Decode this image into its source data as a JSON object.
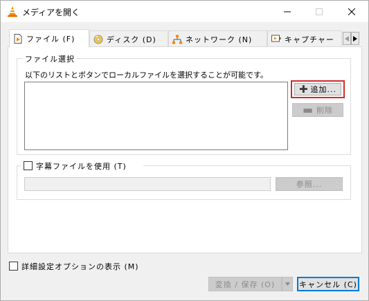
{
  "window": {
    "title": "メディアを開く"
  },
  "tabs": [
    {
      "label": "ファイル (F)",
      "icon": "file-play-icon",
      "active": true
    },
    {
      "label": "ディスク (D)",
      "icon": "disc-icon",
      "active": false
    },
    {
      "label": "ネットワーク (N)",
      "icon": "network-icon",
      "active": false
    },
    {
      "label": "キャプチャー",
      "icon": "capture-device-icon",
      "active": false
    }
  ],
  "file_selection": {
    "group_title": "ファイル選択",
    "description": "以下のリストとボタンでローカルファイルを選択することが可能です。",
    "add_label": "追加...",
    "remove_label": "削除"
  },
  "subtitle": {
    "checkbox_label": "字幕ファイルを使用 (T)",
    "browse_label": "参照...",
    "checked": false
  },
  "advanced": {
    "checkbox_label": "詳細設定オプションの表示 (M)",
    "checked": false
  },
  "footer": {
    "convert_label": "変換 / 保存 (O)",
    "cancel_label": "キャンセル (C)"
  },
  "colors": {
    "highlight_border": "#d12a2a",
    "vlc_orange": "#f08a00",
    "focus_blue": "#0078d7"
  }
}
